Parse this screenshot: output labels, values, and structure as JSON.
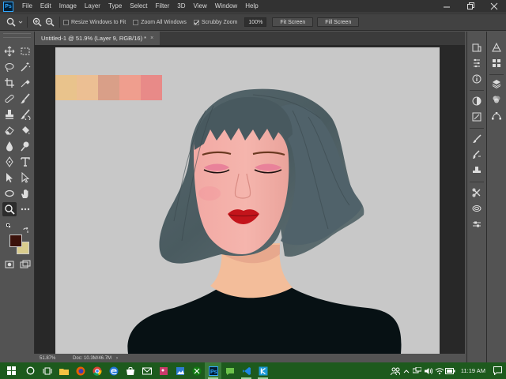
{
  "app": {
    "logo_text": "Ps"
  },
  "menu": [
    "File",
    "Edit",
    "Image",
    "Layer",
    "Type",
    "Select",
    "Filter",
    "3D",
    "View",
    "Window",
    "Help"
  ],
  "options": {
    "resize_windows_label": "Resize Windows to Fit",
    "resize_windows_checked": false,
    "zoom_all_label": "Zoom All Windows",
    "zoom_all_checked": false,
    "scrubby_zoom_label": "Scrubby Zoom",
    "scrubby_zoom_checked": true,
    "zoom_value": "100%",
    "fit_screen_label": "Fit Screen",
    "fill_screen_label": "Fill Screen"
  },
  "document": {
    "tab_title": "Untitled-1 @ 51.9% (Layer 9, RGB/16) *",
    "close_glyph": "×"
  },
  "swatches": [
    "#e9c38c",
    "#ecbf93",
    "#d99f88",
    "#ef9e8e",
    "#e88a88"
  ],
  "colors": {
    "foreground": "#3b120b",
    "background": "#d9cc8d",
    "accent": "#31a8ff"
  },
  "status": {
    "zoom": "51.87%",
    "doc_size": "Doc: 10.3M/46.7M",
    "arrow": "›"
  },
  "tools": [
    "move-tool",
    "marquee-tool",
    "lasso-tool",
    "magic-wand-tool",
    "crop-tool",
    "eyedropper-tool",
    "healing-brush-tool",
    "brush-tool",
    "clone-stamp-tool",
    "history-brush-tool",
    "eraser-tool",
    "paint-bucket-tool",
    "blur-tool",
    "dodge-tool",
    "pen-tool",
    "type-tool",
    "path-selection-tool",
    "rectangle-tool",
    "hand-tool",
    "zoom-tool",
    "more-tools"
  ],
  "taskbar": {
    "time": "11:19 AM"
  }
}
